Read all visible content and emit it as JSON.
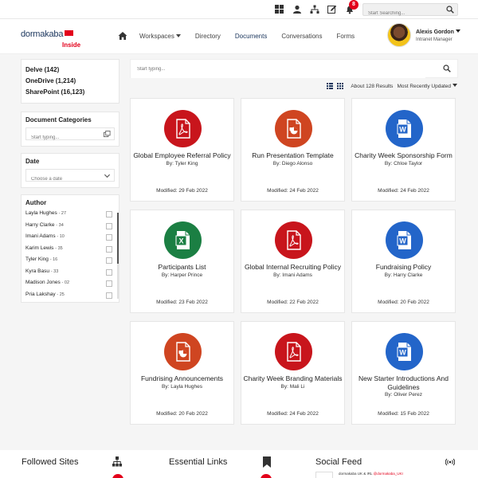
{
  "topbar": {
    "notification_count": "8",
    "search_placeholder": "Start Searching...",
    "icons": [
      "windows-icon",
      "user-icon",
      "sitemap-icon",
      "edit-icon",
      "bell-icon"
    ]
  },
  "nav": {
    "logo": "dormakaba",
    "logo_sub": "Inside",
    "home_icon": "home-icon",
    "items": [
      "Workspaces",
      "Directory",
      "Documents",
      "Conversations",
      "Forms"
    ],
    "active": "Documents"
  },
  "user": {
    "name": "Alexis Gordon",
    "role": "Intranet Manager"
  },
  "sidebar": {
    "sources": [
      "Delve (142)",
      "OneDrive (1,214)",
      "SharePoint (16,123)"
    ],
    "categories": {
      "title": "Document Categories",
      "placeholder": "Start typing..."
    },
    "date": {
      "title": "Date",
      "placeholder": "Choose a date"
    },
    "authors": {
      "title": "Author",
      "items": [
        {
          "name": "Layla Hughes",
          "count": "- 27"
        },
        {
          "name": "Harry Clarke",
          "count": "- 34"
        },
        {
          "name": "Imani Adams",
          "count": "- 10"
        },
        {
          "name": "Karim Lewis",
          "count": "- 35"
        },
        {
          "name": "Tyler King",
          "count": "- 16"
        },
        {
          "name": "Kyra Basu",
          "count": "- 33"
        },
        {
          "name": "Madison Jones",
          "count": "- 02"
        },
        {
          "name": "Pria Lakshay",
          "count": "- 25"
        }
      ]
    }
  },
  "main": {
    "search_placeholder": "Start typing...",
    "results": "About 128 Results",
    "sort": "Most Recently Updated",
    "colors": {
      "pdf": "#c8151c",
      "ppt": "#cf4521",
      "word": "#2365c9",
      "excel": "#1b7f43"
    },
    "cards": [
      {
        "title": "Global Employee Referral Policy",
        "by": "By: Tyler King",
        "modified": "Modified: 29 Feb 2022",
        "type": "pdf"
      },
      {
        "title": "Run Presentation Template",
        "by": "By: Diego Alonso",
        "modified": "Modified: 24 Feb 2022",
        "type": "ppt"
      },
      {
        "title": "Charity Week Sponsorship Form",
        "by": "By: Chloe Taylor",
        "modified": "Modified: 24 Feb 2022",
        "type": "word"
      },
      {
        "title": "Participants List",
        "by": "By: Harper Prince",
        "modified": "Modified: 23 Feb 2022",
        "type": "excel"
      },
      {
        "title": "Global Internal Recruiting Policy",
        "by": "By: Imani Adams",
        "modified": "Modified: 22 Feb 2022",
        "type": "pdf"
      },
      {
        "title": "Fundraising Policy",
        "by": "By: Harry Clarke",
        "modified": "Modified: 20 Feb 2022",
        "type": "word"
      },
      {
        "title": "Fundrising Announcements",
        "by": "By: Layla Hughes",
        "modified": "Modified: 20 Feb 2022",
        "type": "ppt"
      },
      {
        "title": "Charity Week Branding Materials",
        "by": "By: Mali Li",
        "modified": "Modified: 24 Feb 2022",
        "type": "pdf"
      },
      {
        "title": "New Starter Introductions And Guidelines",
        "by": "By: Oliver Perez",
        "modified": "Modified: 15 Feb 2022",
        "type": "word"
      }
    ]
  },
  "footer": {
    "followed_sites": "Followed Sites",
    "essential_links": "Essential Links",
    "social_feed": "Social Feed",
    "feed_preview": "dormakaba UK & IRL",
    "feed_handle": "@dormakaba_UKI"
  }
}
